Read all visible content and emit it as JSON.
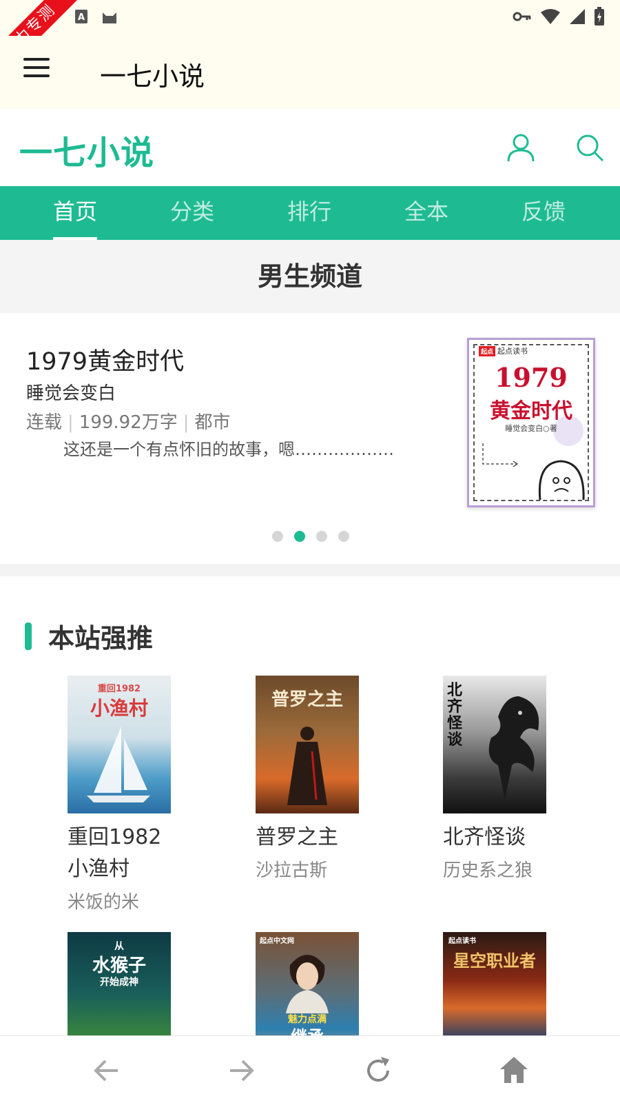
{
  "status_bar": {
    "ribbon_text": "圣力专测",
    "left_icons": [
      "app-a-icon",
      "cat-icon"
    ],
    "right_icons": [
      "key-icon",
      "wifi-icon",
      "signal-icon",
      "battery-icon"
    ]
  },
  "app_bar": {
    "title": "一七小说"
  },
  "site": {
    "logo": "一七小说"
  },
  "nav": {
    "items": [
      {
        "label": "首页",
        "active": true
      },
      {
        "label": "分类"
      },
      {
        "label": "排行"
      },
      {
        "label": "全本"
      },
      {
        "label": "反馈"
      }
    ]
  },
  "channel": {
    "title": "男生频道"
  },
  "featured": {
    "title": "1979黄金时代",
    "author": "睡觉会变白",
    "status": "连载",
    "words": "199.92万字",
    "genre": "都市",
    "description": "这还是一个有点怀旧的故事，嗯………………",
    "cover": {
      "brand": "起点读书",
      "brand_badge": "起点",
      "year": "1979",
      "name": "黄金时代",
      "sub": "睡觉会变白○著"
    },
    "dots": 4,
    "active_dot": 2
  },
  "recommend": {
    "title": "本站强推",
    "books": [
      {
        "title": "重回1982小渔村",
        "author": "米饭的米",
        "cover_top": "重回1982",
        "cover_main": "小渔村"
      },
      {
        "title": "普罗之主",
        "author": "沙拉古斯",
        "cover_main": "普罗之主"
      },
      {
        "title": "北齐怪谈",
        "author": "历史系之狼",
        "cover_main": "北齐怪谈"
      },
      {
        "cover_top": "从",
        "cover_main": "水猴子",
        "cover_sub": "开始成神"
      },
      {
        "cover_top": "起点中文网",
        "cover_main": "魅力点满",
        "cover_sub": "继承"
      },
      {
        "cover_top": "起点读书",
        "cover_main": "星空职业者"
      }
    ]
  },
  "colors": {
    "accent": "#1ebb93",
    "status_bg": "#fffdf0",
    "ribbon": "#e8101a"
  }
}
